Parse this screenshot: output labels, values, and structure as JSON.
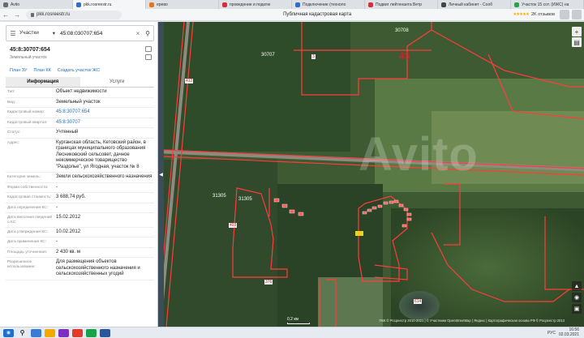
{
  "browser": {
    "tabs": [
      {
        "label": "Avito",
        "color": "#6b6b6b"
      },
      {
        "label": "pkk.rosreestr.ru",
        "color": "#2a6fc9"
      },
      {
        "label": "ерево",
        "color": "#e8731a"
      },
      {
        "label": "проведение и подклю",
        "color": "#d3303a"
      },
      {
        "label": "Подключение (техноло",
        "color": "#2a6fc9"
      },
      {
        "label": "Подвиг лейтенанта Ветр",
        "color": "#d3303a"
      },
      {
        "label": "Личный кабинет - Сооб",
        "color": "#444444"
      },
      {
        "label": "Участок 15 сот. (ИЖС) на",
        "color": "#2ba24c"
      }
    ],
    "url": "pkk.rosreestr.ru",
    "page_title": "Публичная кадастровая карта",
    "rating_value": "2K отзывов",
    "stars": "★★★★★"
  },
  "panel": {
    "search_type": "Участки",
    "search_value": "45:08:030707:654",
    "object_title": "45:8:30707:654",
    "object_subtitle": "Земельный участок",
    "links": [
      "План ЗУ",
      "План КК",
      "Создать участок ЖС"
    ],
    "tabs": [
      "Информация",
      "Услуги"
    ],
    "rows": [
      {
        "k": "Тип:",
        "v": "Объект недвижимости",
        "link": false
      },
      {
        "k": "Вид:",
        "v": "Земельный участок",
        "link": false
      },
      {
        "k": "Кадастровый номер:",
        "v": "45:8:30707:654",
        "link": true
      },
      {
        "k": "Кадастровый квартал:",
        "v": "45:8:30707",
        "link": true
      },
      {
        "k": "Статус:",
        "v": "Учтенный",
        "link": false
      },
      {
        "k": "Адрес:",
        "v": "Курганская область, Кетовский район, в границах муниципального образования Лесниковский сельсовет, дачное некоммерческое товарищество \"Раздолье\", ул Ягодная, участок № 8",
        "link": false
      },
      {
        "k": "Категория земель:",
        "v": "Земли сельскохозяйственного назначения",
        "link": false
      },
      {
        "k": "Форма собственности:",
        "v": "-",
        "link": false
      },
      {
        "k": "Кадастровая стоимость:",
        "v": "3 688,74 руб.",
        "link": false
      },
      {
        "k": "Дата определения КС:",
        "v": "-",
        "link": false
      },
      {
        "k": "Дата внесения сведений о КС:",
        "v": "15.02.2012",
        "link": false
      },
      {
        "k": "Дата утверждения КС:",
        "v": "10.02.2012",
        "link": false
      },
      {
        "k": "Дата применения КС:",
        "v": "-",
        "link": false
      },
      {
        "k": "Площадь уточненная:",
        "v": "2 430 кв. м",
        "link": false
      },
      {
        "k": "Разрешенное использование:",
        "v": "Для размещения объектов сельскохозяйственного назначения и сельскохозяйственных угодий",
        "link": false
      }
    ]
  },
  "map": {
    "watermark": "Avito",
    "labels": [
      "45",
      "30707",
      "30708",
      "31305",
      "31305",
      "614"
    ],
    "plates": [
      "3",
      "376",
      "412",
      "403"
    ],
    "scale": "0.2 км",
    "attribution": "ПКК © Росреестр 2010-2021 | © Участники OpenStreetMap | Яндекс | Картографическая основа РФ © Росреестр 2013"
  },
  "taskbar": {
    "lang": "РУС",
    "time": "16:56",
    "date": "02.03.2021"
  }
}
